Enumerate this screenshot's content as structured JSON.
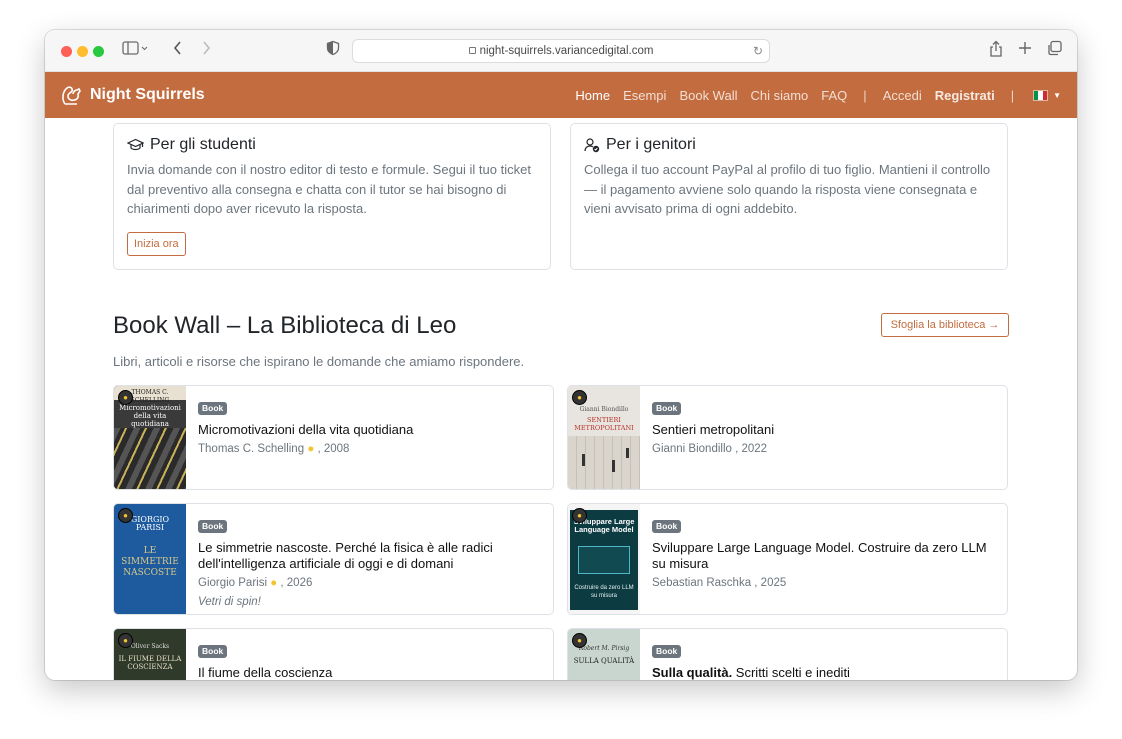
{
  "browser": {
    "url": "night-squirrels.variancedigital.com"
  },
  "navbar": {
    "brand": "Night Squirrels",
    "links": [
      "Home",
      "Esempi",
      "Book Wall",
      "Chi siamo",
      "FAQ"
    ],
    "separator": "|",
    "login": "Accedi",
    "register": "Registrati"
  },
  "features": {
    "students": {
      "title": "Per gli studenti",
      "text": "Invia domande con il nostro editor di testo e formule. Segui il tuo ticket dal preventivo alla consegna e chatta con il tutor se hai bisogno di chiarimenti dopo aver ricevuto la risposta.",
      "button": "Inizia ora"
    },
    "parents": {
      "title": "Per i genitori",
      "text": "Collega il tuo account PayPal al profilo di tuo figlio. Mantieni il controllo — il pagamento avviene solo quando la risposta viene consegnata e vieni avvisato prima di ogni addebito."
    }
  },
  "bookwall": {
    "title": "Book Wall – La Biblioteca di Leo",
    "browse": "Sfoglia la biblioteca →",
    "subtitle": "Libri, articoli e risorse che ispirano le domande che amiamo rispondere.",
    "books": [
      {
        "badge": "Book",
        "title": "Micromotivazioni della vita quotidiana",
        "author": "Thomas C. Schelling",
        "year": ", 2008",
        "cover_text": "Micromotivazioni della vita quotidiana",
        "cover_author": "THOMAS C. SCHELLING"
      },
      {
        "badge": "Book",
        "title": "Sentieri metropolitani",
        "author": "Gianni Biondillo ",
        "year": ", 2022",
        "cover_text": "SENTIERI METROPOLITANI",
        "cover_author": "Gianni Biondillo"
      },
      {
        "badge": "Book",
        "title": "Le simmetrie nascoste. Perché la fisica è alle radici dell'intelligenza artificiale di oggi e di domani",
        "author": "Giorgio Parisi",
        "year": ", 2026",
        "note": "Vetri di spin!",
        "cover_text": "LE SIMMETRIE NASCOSTE",
        "cover_author": "GIORGIO PARISI"
      },
      {
        "badge": "Book",
        "title": "Sviluppare Large Language Model. Costruire da zero LLM su misura",
        "author": "Sebastian Raschka ",
        "year": ", 2025",
        "cover_text": "Sviluppare Large Language Model",
        "cover_author": "Costruire da zero LLM su misura"
      },
      {
        "badge": "Book",
        "title": "Il fiume della coscienza",
        "cover_text": "IL FIUME DELLA COSCIENZA",
        "cover_author": "Oliver Sacks"
      },
      {
        "badge": "Book",
        "title_bold": "Sulla qualità.",
        "title_rest": " Scritti scelti e inediti",
        "cover_text": "SULLA QUALITÀ",
        "cover_author": "Robert M. Pirsig"
      }
    ]
  },
  "colors": {
    "brand": "#c36c3f",
    "badge": "#6c757d"
  }
}
